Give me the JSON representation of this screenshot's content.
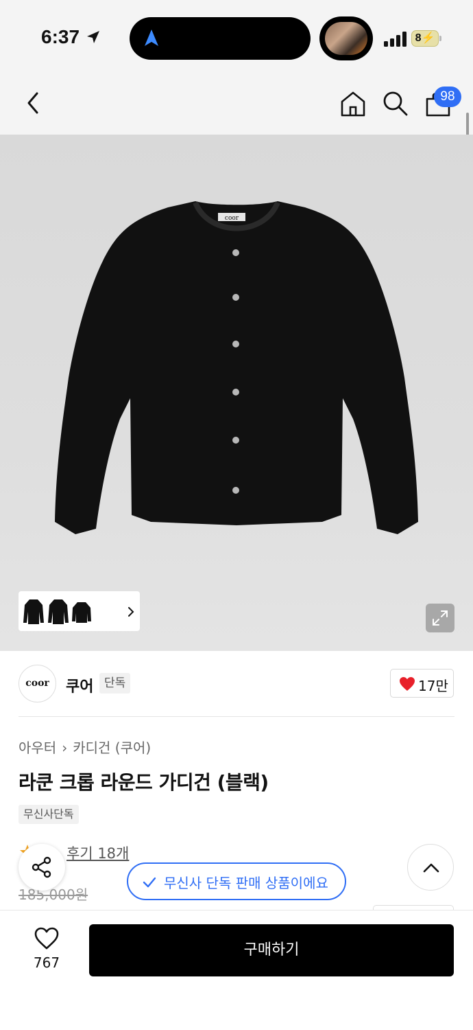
{
  "status_bar": {
    "time": "6:37",
    "battery": "8",
    "icons": [
      "location-arrow-icon",
      "navigation-icon",
      "signal-icon",
      "battery-charging-icon"
    ]
  },
  "nav": {
    "cart_count": "98",
    "icons": [
      "back-icon",
      "home-icon",
      "search-icon",
      "shopping-bag-icon"
    ]
  },
  "product": {
    "brand_logo_text": "coor",
    "label_text": "coor",
    "brand_name": "쿠어",
    "brand_tag": "단독",
    "like_count": "17만",
    "breadcrumb": [
      "아우터",
      "카디건 (쿠어)"
    ],
    "title": "라쿤 크롭 라운드 가디건 (블랙)",
    "store_tag": "무신사단독",
    "reviews": "후기 18개",
    "original_price": "185,000원"
  },
  "floating": {
    "exclusive_notice": "무신사 단독 판매 상품이에요"
  },
  "bottom_bar": {
    "wishlist_count": "767",
    "buy_label": "구매하기"
  },
  "colors": {
    "accent": "#2f6ef5",
    "heart": "#e8202a",
    "buy_button": "#000000"
  }
}
